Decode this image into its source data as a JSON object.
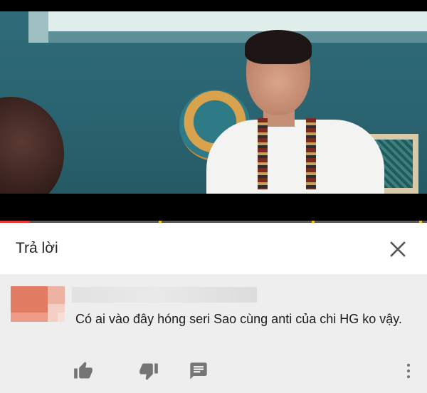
{
  "video": {
    "progress_fraction": 0.07,
    "chapter_marker_fractions": [
      0.375,
      0.733,
      0.985
    ]
  },
  "reply_panel": {
    "title": "Trả lời",
    "close_icon": "close-icon"
  },
  "comment": {
    "text": "Có ai vào đây hóng seri Sao cùng anti của chi HG ko vậy.",
    "actions": {
      "like_icon": "thumbs-up-icon",
      "dislike_icon": "thumbs-down-icon",
      "reply_icon": "comment-icon",
      "more_icon": "more-vert-icon"
    }
  },
  "colors": {
    "progress": "#e53935",
    "icon": "#757575"
  }
}
